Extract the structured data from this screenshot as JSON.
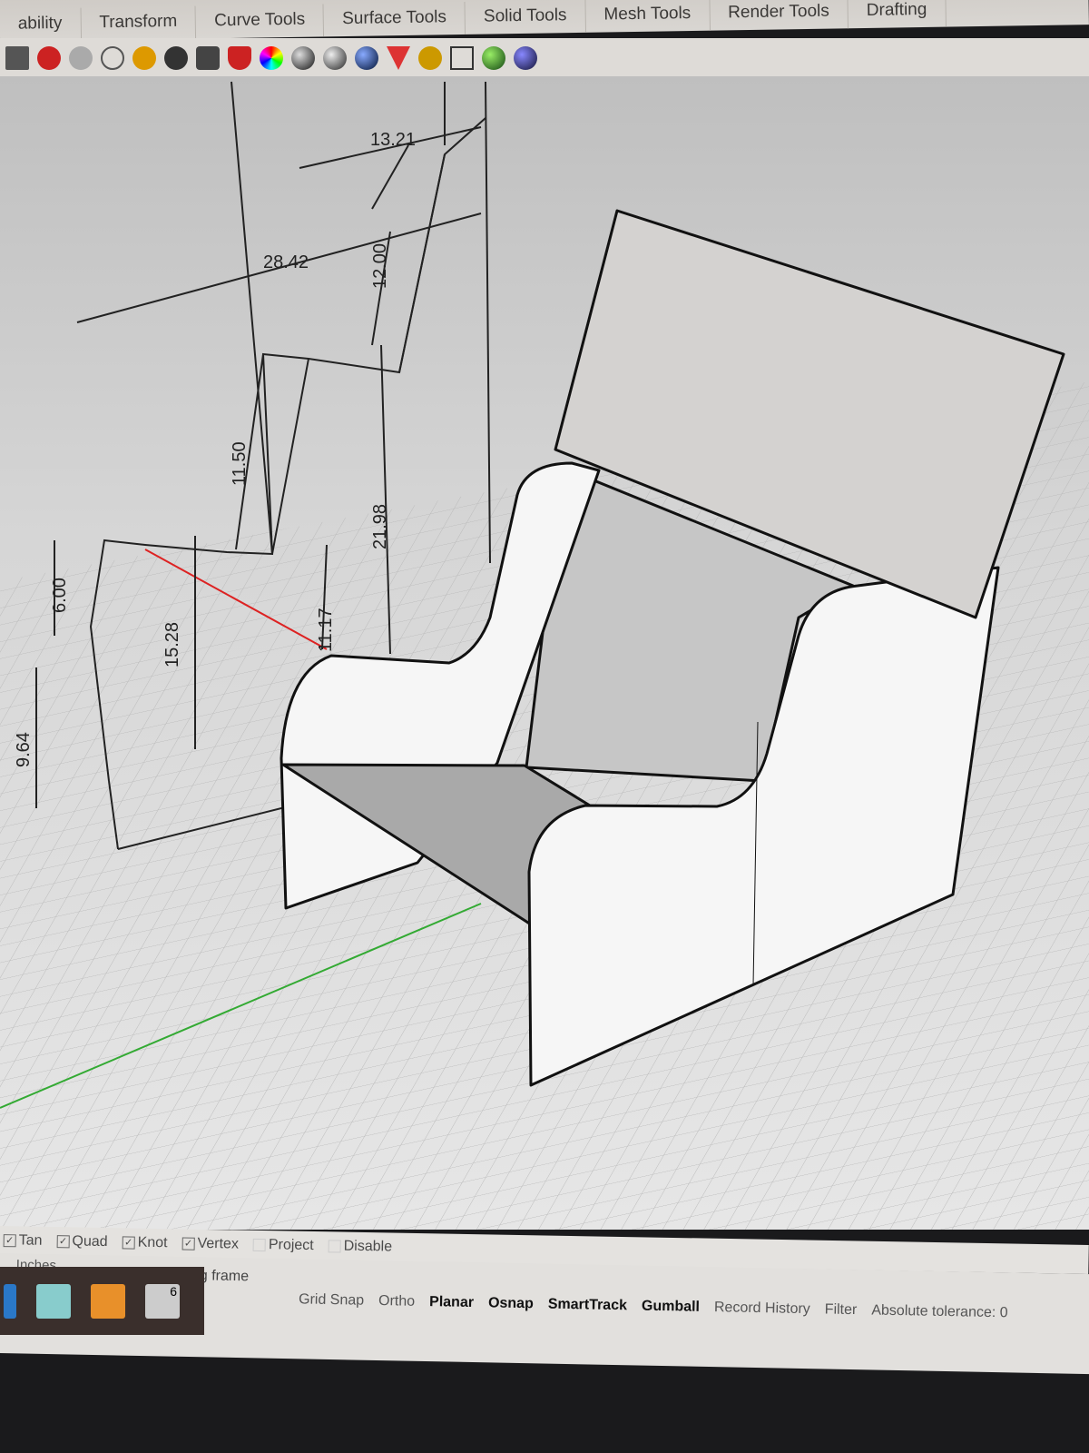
{
  "tabs": [
    "ability",
    "Transform",
    "Curve Tools",
    "Surface Tools",
    "Solid Tools",
    "Mesh Tools",
    "Render Tools",
    "Drafting"
  ],
  "toolbar_icons": [
    "grid-icon",
    "car-icon",
    "cloud-icon",
    "circle-arrow-icon",
    "link-icon",
    "light-bulb-icon",
    "lock-icon",
    "shield-icon",
    "color-wheel-icon",
    "sphere-icon",
    "sphere-icon",
    "blue-sphere-icon",
    "flag-icon",
    "gear-icon",
    "block-icon",
    "green-globe-icon",
    "help-icon"
  ],
  "dimensions": [
    "13.21",
    "28.42",
    "12.00",
    "11.50",
    "21.98",
    "6.00",
    "15.28",
    "11.17",
    "9.64"
  ],
  "osnap": [
    {
      "label": "Tan",
      "checked": true
    },
    {
      "label": "Quad",
      "checked": true
    },
    {
      "label": "Knot",
      "checked": true
    },
    {
      "label": "Vertex",
      "checked": true
    },
    {
      "label": "Project",
      "checked": false
    },
    {
      "label": "Disable",
      "checked": false
    }
  ],
  "status": {
    "units": "Inches",
    "layer": "wooden casting frame",
    "panes": [
      "Grid Snap",
      "Ortho",
      "Planar",
      "Osnap",
      "SmartTrack",
      "Gumball",
      "Record History",
      "Filter",
      "Absolute tolerance: 0"
    ],
    "active": [
      false,
      false,
      true,
      true,
      true,
      true,
      false,
      false,
      false
    ]
  },
  "taskbar_badge": "6"
}
